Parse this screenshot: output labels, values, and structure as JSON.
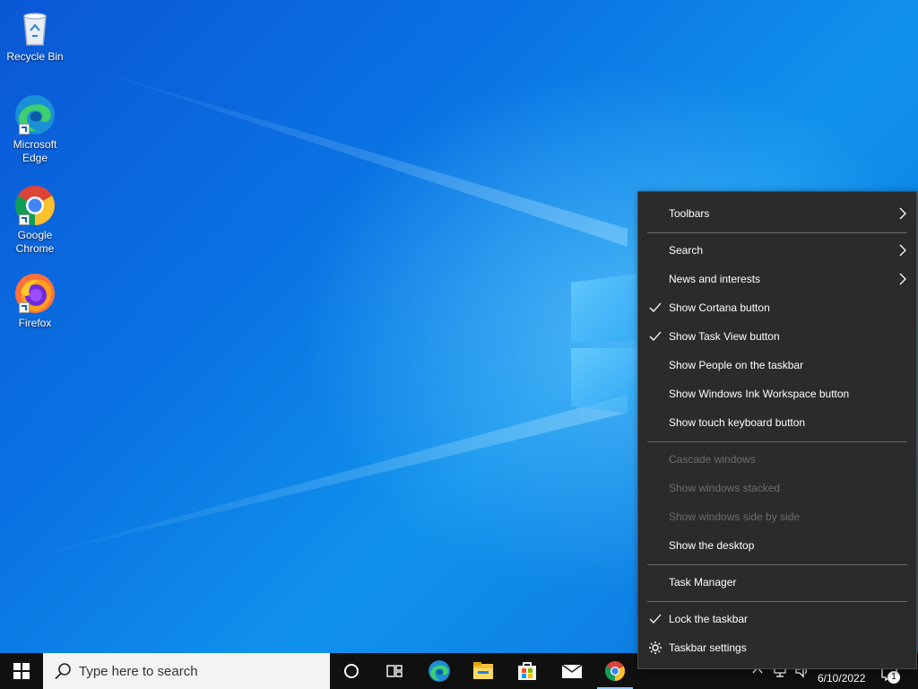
{
  "desktop": {
    "icons": [
      {
        "label_line1": "Recycle Bin",
        "label_line2": "",
        "icon": "recycle-bin-icon"
      },
      {
        "label_line1": "Microsoft",
        "label_line2": "Edge",
        "icon": "edge-icon"
      },
      {
        "label_line1": "Google",
        "label_line2": "Chrome",
        "icon": "chrome-icon"
      },
      {
        "label_line1": "Firefox",
        "label_line2": "",
        "icon": "firefox-icon"
      }
    ]
  },
  "context_menu": {
    "items": [
      {
        "label": "Toolbars",
        "checked": false,
        "submenu": true,
        "disabled": false
      },
      {
        "label": "Search",
        "checked": false,
        "submenu": true,
        "disabled": false
      },
      {
        "label": "News and interests",
        "checked": false,
        "submenu": true,
        "disabled": false
      },
      {
        "label": "Show Cortana button",
        "checked": true,
        "submenu": false,
        "disabled": false
      },
      {
        "label": "Show Task View button",
        "checked": true,
        "submenu": false,
        "disabled": false
      },
      {
        "label": "Show People on the taskbar",
        "checked": false,
        "submenu": false,
        "disabled": false
      },
      {
        "label": "Show Windows Ink Workspace button",
        "checked": false,
        "submenu": false,
        "disabled": false
      },
      {
        "label": "Show touch keyboard button",
        "checked": false,
        "submenu": false,
        "disabled": false
      },
      {
        "label": "Cascade windows",
        "checked": false,
        "submenu": false,
        "disabled": true
      },
      {
        "label": "Show windows stacked",
        "checked": false,
        "submenu": false,
        "disabled": true
      },
      {
        "label": "Show windows side by side",
        "checked": false,
        "submenu": false,
        "disabled": true
      },
      {
        "label": "Show the desktop",
        "checked": false,
        "submenu": false,
        "disabled": false
      },
      {
        "label": "Task Manager",
        "checked": false,
        "submenu": false,
        "disabled": false
      },
      {
        "label": "Lock the taskbar",
        "checked": true,
        "submenu": false,
        "disabled": false
      },
      {
        "label": "Taskbar settings",
        "checked": false,
        "submenu": false,
        "disabled": false,
        "icon": "gear-icon"
      }
    ]
  },
  "taskbar": {
    "search_placeholder": "Type here to search",
    "pinned": [
      "cortana-icon",
      "task-view-icon",
      "edge-icon",
      "file-explorer-icon",
      "store-icon",
      "mail-icon",
      "chrome-icon"
    ],
    "date": "6/10/2022",
    "notification_count": "1"
  },
  "colors": {
    "menu_bg": "#2b2b2b",
    "taskbar_bg": "#101010",
    "desktop_blue": "#0a74e3"
  }
}
